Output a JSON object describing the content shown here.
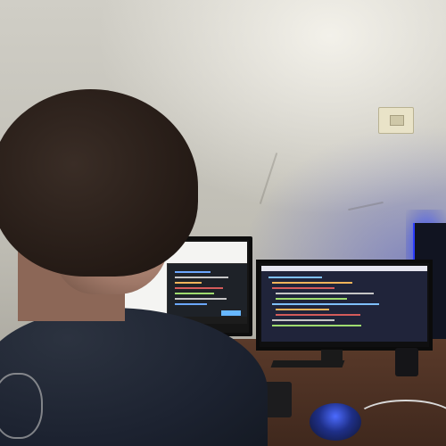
{
  "scene": {
    "subject": "",
    "colors": {
      "wall": "#c9c7bf",
      "desk": "#4a3022",
      "accent_blue": "#3e53ff",
      "shirt": "#1c2230",
      "hair": "#241a15"
    },
    "icons": [
      "outlet-icon",
      "monitor-icon",
      "keyboard-icon",
      "mouse-icon"
    ]
  }
}
